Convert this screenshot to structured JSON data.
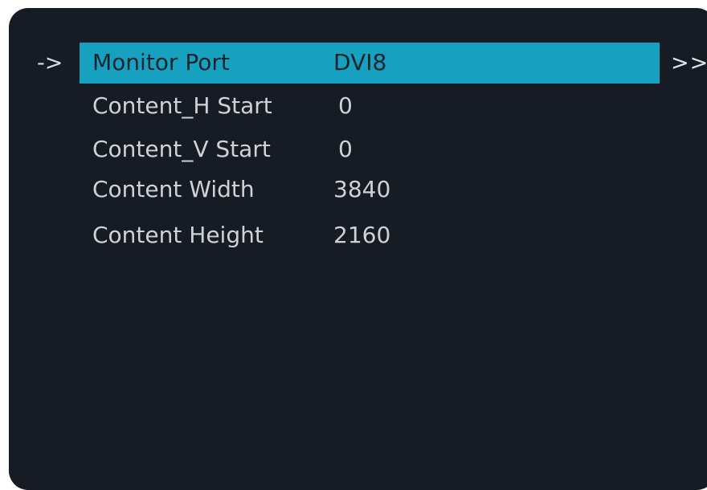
{
  "menu": {
    "cursor": "->",
    "more": ">>",
    "rows": [
      {
        "label": "Monitor Port",
        "value": "DVI8"
      },
      {
        "label": "Content_H Start",
        "value": "0"
      },
      {
        "label": "Content_V Start",
        "value": "0"
      },
      {
        "label": "Content Width",
        "value": "3840"
      },
      {
        "label": "Content Height",
        "value": "2160"
      }
    ],
    "selected_index": 0
  },
  "colors": {
    "background": "#171c24",
    "highlight": "#16a1c1",
    "text": "#ced2d7",
    "selected_text": "#16232d"
  }
}
